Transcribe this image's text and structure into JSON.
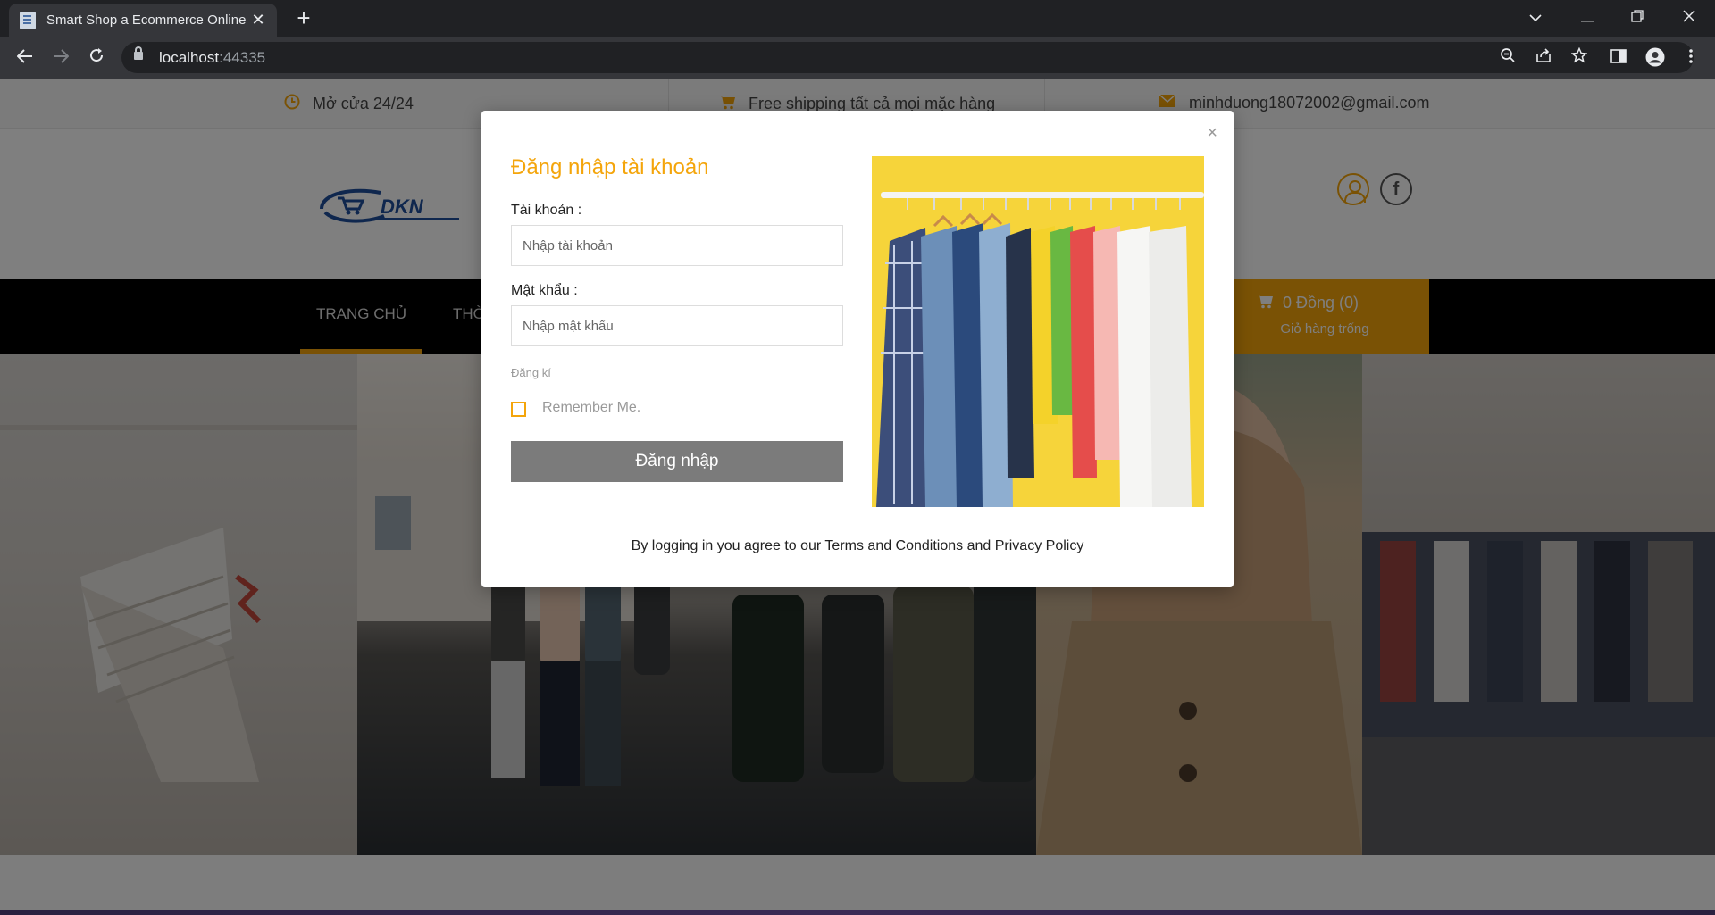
{
  "browser": {
    "tab_title": "Smart Shop a Ecommerce Online",
    "tab_close": "✕",
    "new_tab": "+",
    "url_host": "localhost",
    "url_port": ":44335"
  },
  "topinfo": {
    "hours": "Mở cửa 24/24",
    "shipping": "Free shipping tất cả mọi mặc hàng",
    "email": "minhduong18072002@gmail.com"
  },
  "header": {
    "logo_text": "DKN",
    "facebook_glyph": "f"
  },
  "nav": {
    "items": [
      "TRANG CHỦ",
      "THỜ"
    ],
    "cart_total": "0 Đồng (0)",
    "cart_status": "Giỏ hàng trống"
  },
  "modal": {
    "close": "×",
    "title": "Đăng nhập tài khoản",
    "username_label": "Tài khoản :",
    "username_placeholder": "Nhập tài khoản",
    "password_label": "Mật khẩu :",
    "password_placeholder": "Nhập mật khẩu",
    "signup_link": "Đăng kí",
    "remember_label": "Remember Me.",
    "remember_checked": false,
    "login_button": "Đăng nhập",
    "terms": "By logging in you agree to our Terms and Conditions and Privacy Policy"
  },
  "colors": {
    "accent": "#f4a50b",
    "navbar": "#000000",
    "login_button": "#7b7b7b"
  }
}
